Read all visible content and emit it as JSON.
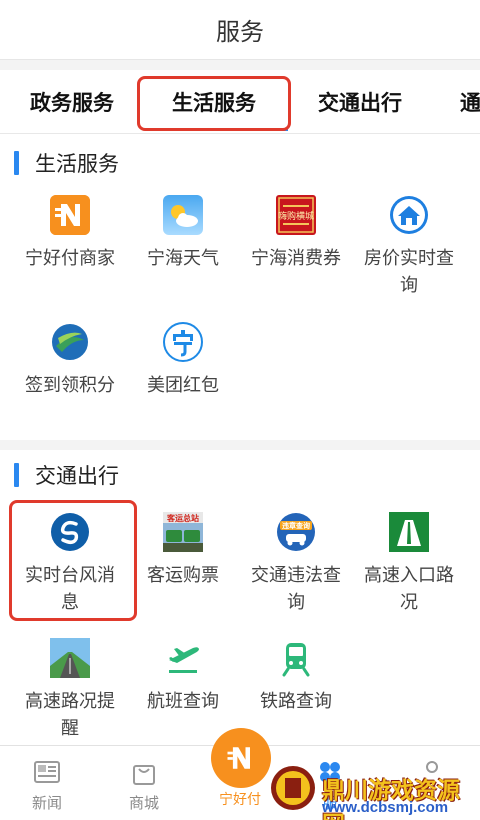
{
  "header": {
    "title": "服务"
  },
  "tabs": [
    {
      "label": "政务服务"
    },
    {
      "label": "生活服务"
    },
    {
      "label": "交通出行"
    },
    {
      "label": "通"
    }
  ],
  "sections": {
    "life": {
      "title": "生活服务",
      "items": [
        {
          "label": "宁好付商家",
          "icon": "ning-pay-merchant-icon"
        },
        {
          "label": "宁海天气",
          "icon": "weather-icon"
        },
        {
          "label": "宁海消费券",
          "icon": "coupon-icon"
        },
        {
          "label": "房价实时查询",
          "icon": "house-price-icon"
        },
        {
          "label": "签到领积分",
          "icon": "checkin-points-icon"
        },
        {
          "label": "美团红包",
          "icon": "meituan-redpacket-icon"
        }
      ]
    },
    "traffic": {
      "title": "交通出行",
      "items": [
        {
          "label": "实时台风消息",
          "icon": "typhoon-icon"
        },
        {
          "label": "客运购票",
          "icon": "bus-ticket-icon",
          "icon_text": "客运总站"
        },
        {
          "label": "交通违法查询",
          "icon": "traffic-violation-icon",
          "icon_text": "违章查询"
        },
        {
          "label": "高速入口路况",
          "icon": "highway-entrance-icon"
        },
        {
          "label": "高速路况提醒",
          "icon": "highway-alert-icon"
        },
        {
          "label": "航班查询",
          "icon": "flight-icon"
        },
        {
          "label": "铁路查询",
          "icon": "railway-icon"
        }
      ]
    }
  },
  "coupon_icon_text": "嗨购横城",
  "tabbar": {
    "items": [
      {
        "label": "新闻"
      },
      {
        "label": "商城"
      },
      {
        "label": "宁好付"
      },
      {
        "label": "服"
      },
      {
        "label": ""
      }
    ]
  },
  "watermark": {
    "brand": "鼎川游戏资源网",
    "url": "www.dcbsmj.com"
  },
  "colors": {
    "accent": "#2a88f0",
    "highlight": "#e03a2c",
    "orange": "#f7901e"
  }
}
